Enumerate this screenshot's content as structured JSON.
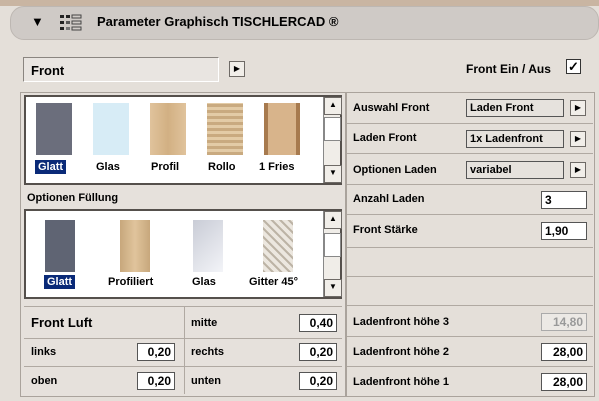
{
  "header": {
    "title": "Parameter Graphisch TISCHLERCAD ®",
    "icon": "list-icon",
    "arrow": "▼"
  },
  "front": {
    "selector_value": "Front",
    "toggle_label": "Front Ein / Aus",
    "toggle_checked": true
  },
  "gallery_front": {
    "items": [
      {
        "label": "Glatt",
        "selected": true,
        "color": "#6b6e7c"
      },
      {
        "label": "Glas",
        "selected": false,
        "color": "#d7ecf6"
      },
      {
        "label": "Profil",
        "selected": false,
        "color": "#d9b991"
      },
      {
        "label": "Rollo",
        "selected": false,
        "color": "#c9aa80"
      },
      {
        "label": "1 Fries",
        "selected": false,
        "color": "#c79a6c"
      }
    ]
  },
  "fill_options": {
    "title": "Optionen Füllung"
  },
  "gallery_fill": {
    "items": [
      {
        "label": "Glatt",
        "selected": true,
        "color": "#5f6473"
      },
      {
        "label": "Profiliert",
        "selected": false,
        "color": "#d3b68e"
      },
      {
        "label": "Glas",
        "selected": false,
        "color": "#e3e6ee"
      },
      {
        "label": "Gitter 45°",
        "selected": false,
        "color": "#d8d2c8"
      }
    ]
  },
  "luft": {
    "title": "Front Luft",
    "links_label": "links",
    "links_value": "0,20",
    "oben_label": "oben",
    "oben_value": "0,20",
    "mitte_label": "mitte",
    "mitte_value": "0,40",
    "rechts_label": "rechts",
    "rechts_value": "0,20",
    "unten_label": "unten",
    "unten_value": "0,20"
  },
  "right": {
    "auswahl_label": "Auswahl Front",
    "auswahl_value": "Laden Front",
    "laden_label": "Laden Front",
    "laden_value": "1x Ladenfront",
    "optionen_label": "Optionen Laden",
    "optionen_value": "variabel",
    "anzahl_label": "Anzahl Laden",
    "anzahl_value": "3",
    "staerke_label": "Front Stärke",
    "staerke_value": "1,90",
    "h3_label": "Ladenfront höhe 3",
    "h3_value": "14,80",
    "h2_label": "Ladenfront höhe 2",
    "h2_value": "28,00",
    "h1_label": "Ladenfront höhe 1",
    "h1_value": "28,00"
  }
}
